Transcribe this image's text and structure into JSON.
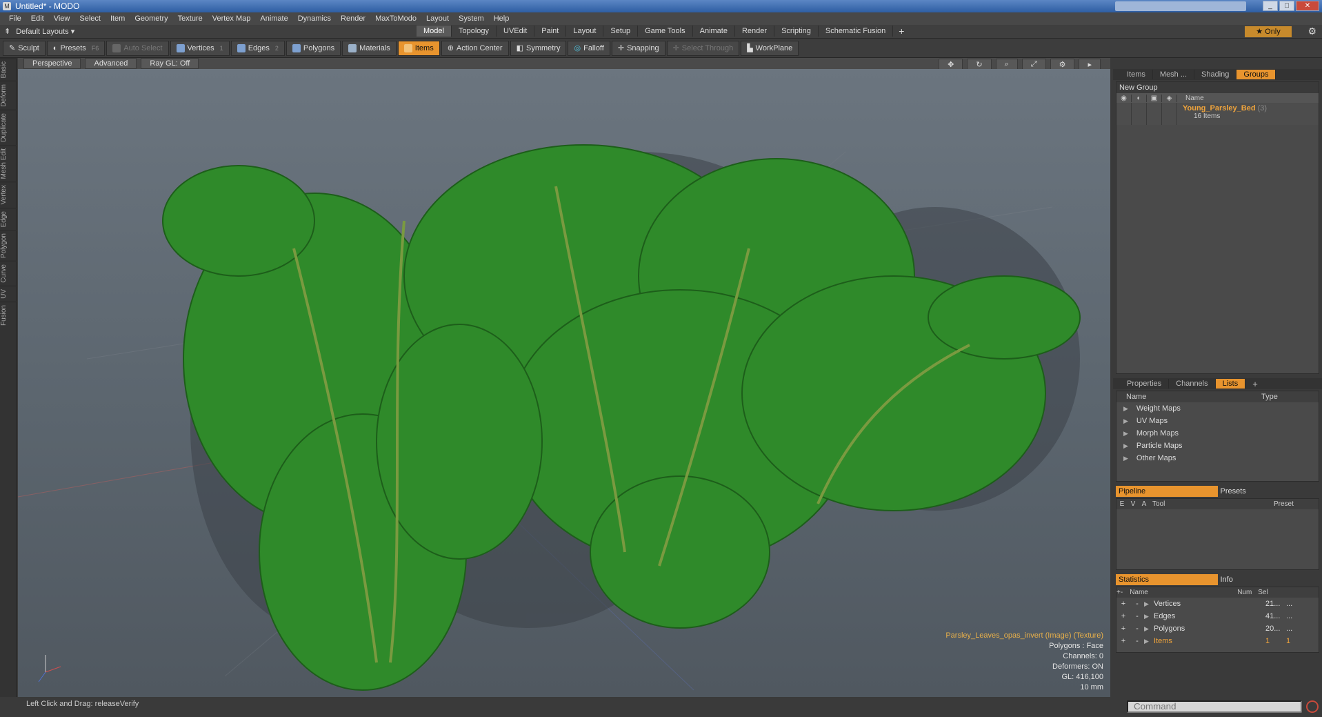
{
  "window": {
    "title": "Untitled* - MODO",
    "controls": [
      "_",
      "□",
      "✕"
    ]
  },
  "menu": [
    "File",
    "Edit",
    "View",
    "Select",
    "Item",
    "Geometry",
    "Texture",
    "Vertex Map",
    "Animate",
    "Dynamics",
    "Render",
    "MaxToModo",
    "Layout",
    "System",
    "Help"
  ],
  "layout": {
    "label": "Default Layouts ▾"
  },
  "modes": [
    "Model",
    "Topology",
    "UVEdit",
    "Paint",
    "Layout",
    "Setup",
    "Game Tools",
    "Animate",
    "Render",
    "Scripting",
    "Schematic Fusion"
  ],
  "only_label": "★  Only",
  "toolbar": {
    "sculpt": "Sculpt",
    "presets": "Presets",
    "presets_key": "F6",
    "auto_select": "Auto Select",
    "vertices": "Vertices",
    "vertices_key": "1",
    "edges": "Edges",
    "edges_key": "2",
    "polygons": "Polygons",
    "materials": "Materials",
    "items": "Items",
    "action_center": "Action Center",
    "symmetry": "Symmetry",
    "falloff": "Falloff",
    "snapping": "Snapping",
    "select_through": "Select Through",
    "workplane": "WorkPlane"
  },
  "left_tabs": [
    "Basic",
    "Deform",
    "Duplicate",
    "Mesh Edit",
    "Vertex",
    "Edge",
    "Polygon",
    "Curve",
    "UV",
    "Fusion"
  ],
  "viewport": {
    "buttons": [
      "Perspective",
      "Advanced",
      "Ray GL: Off"
    ],
    "info": {
      "texture": "Parsley_Leaves_opas_invert (Image) (Texture)",
      "polygons": "Polygons : Face",
      "channels": "Channels: 0",
      "deformers": "Deformers: ON",
      "gl": "GL: 416,100",
      "scale": "10 mm"
    }
  },
  "status": "Left Click and Drag:  releaseVerify",
  "groups_panel": {
    "tabs": [
      "Items",
      "Mesh ...",
      "Shading",
      "Groups"
    ],
    "new_group": "New Group",
    "name_header": "Name",
    "group_name": "Young_Parsley_Bed",
    "group_suffix": "(3)",
    "group_count": "16 Items"
  },
  "lists_panel": {
    "tabs": [
      "Properties",
      "Channels",
      "Lists"
    ],
    "headers": [
      "Name",
      "Type"
    ],
    "rows": [
      "Weight Maps",
      "UV Maps",
      "Morph Maps",
      "Particle Maps",
      "Other Maps"
    ]
  },
  "pipeline_panel": {
    "tabs": [
      "Pipeline",
      "Presets"
    ],
    "headers": [
      "E",
      "V",
      "A",
      "Tool",
      "Preset"
    ]
  },
  "stats_panel": {
    "tabs": [
      "Statistics",
      "Info"
    ],
    "headers": [
      "Name",
      "Num",
      "Sel"
    ],
    "rows": [
      {
        "name": "Vertices",
        "num": "21...",
        "sel": "..."
      },
      {
        "name": "Edges",
        "num": "41...",
        "sel": "..."
      },
      {
        "name": "Polygons",
        "num": "20...",
        "sel": "..."
      },
      {
        "name": "Items",
        "num": "1",
        "sel": "1"
      }
    ]
  },
  "command": {
    "placeholder": "Command"
  },
  "colors": {
    "accent": "#e8942e",
    "foliage": "#2f8a2a",
    "foliage_dark": "#1d5e1a",
    "group_name": "#f0a43c"
  }
}
